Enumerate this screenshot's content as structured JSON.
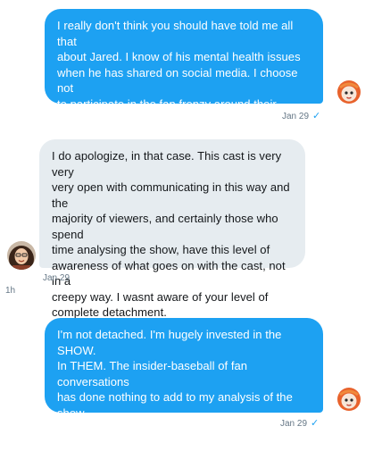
{
  "messages": [
    {
      "direction": "outgoing",
      "text": "I really don't think you should have told me all that\nabout Jared. I know of his mental health issues\nwhen he has shared on social media. I choose not\nto participate in the fan frenzy around their personal\nlives, which I said in my Tweets to you.",
      "timestamp": "Jan 29",
      "read_icon": "checkmark-icon"
    },
    {
      "direction": "incoming",
      "text": "I do apologize, in that case. This cast is very very\nvery open with communicating in this way and the\nmajority of viewers, and certainly those who spend\ntime analysing the show, have this level of\nawareness of what goes on with the cast,  not in a\ncreepy way. I wasnt aware of your level of\ncomplete detachment.",
      "timestamp": "Jan 29"
    },
    {
      "direction": "outgoing",
      "text": "I'm not detached. I'm hugely invested in the SHOW.\nIn THEM. The insider-baseball of fan conversations\nhas done nothing to add to my analysis of the show\non my site. It's just not how I engage with material.\never.",
      "timestamp": "Jan 29",
      "read_icon": "checkmark-icon"
    }
  ],
  "gap_label": "1h",
  "colors": {
    "outgoing_bubble": "#1da1f2",
    "incoming_bubble": "#e6ecf0",
    "meta_text": "#657786"
  }
}
